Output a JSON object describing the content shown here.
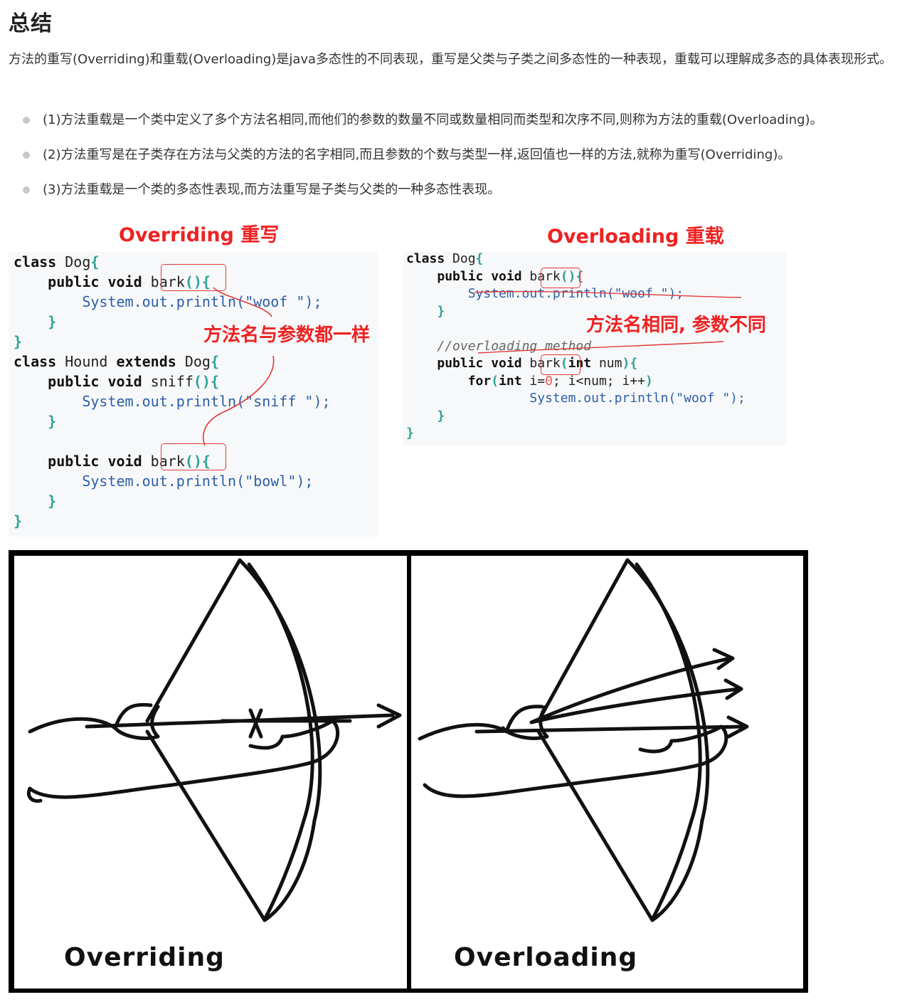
{
  "heading": "总结",
  "intro": "方法的重写(Overriding)和重载(Overloading)是java多态性的不同表现，重写是父类与子类之间多态性的一种表现，重载可以理解成多态的具体表现形式。",
  "bullets": [
    "(1)方法重载是一个类中定义了多个方法名相同,而他们的参数的数量不同或数量相同而类型和次序不同,则称为方法的重载(Overloading)。",
    "(2)方法重写是在子类存在方法与父类的方法的名字相同,而且参数的个数与类型一样,返回值也一样的方法,就称为重写(Overriding)。",
    "(3)方法重载是一个类的多态性表现,而方法重写是子类与父类的一种多态性表现。"
  ],
  "code_figure": {
    "left_title": "Overriding  重写",
    "left_note": "方法名与参数都一样",
    "right_title": "Overloading  重载",
    "right_note": "方法名相同, 参数不同"
  },
  "bow_figure": {
    "left_label": "Overriding",
    "right_label": "Overloading"
  },
  "colors": {
    "annotation_red": "#ee2222",
    "bullet_dot": "#c8c8c8",
    "code_bg": "#f7f8f9"
  }
}
